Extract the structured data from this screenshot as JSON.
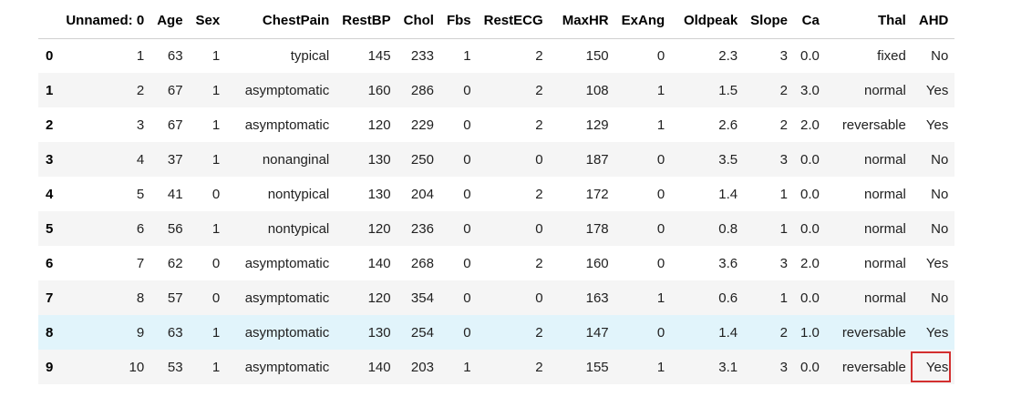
{
  "table": {
    "columns": [
      "",
      "Unnamed: 0",
      "Age",
      "Sex",
      "ChestPain",
      "RestBP",
      "Chol",
      "Fbs",
      "RestECG",
      "MaxHR",
      "ExAng",
      "Oldpeak",
      "Slope",
      "Ca",
      "Thal",
      "AHD"
    ],
    "rows": [
      {
        "index": "0",
        "cells": [
          "1",
          "63",
          "1",
          "typical",
          "145",
          "233",
          "1",
          "2",
          "150",
          "0",
          "2.3",
          "3",
          "0.0",
          "fixed",
          "No"
        ]
      },
      {
        "index": "1",
        "cells": [
          "2",
          "67",
          "1",
          "asymptomatic",
          "160",
          "286",
          "0",
          "2",
          "108",
          "1",
          "1.5",
          "2",
          "3.0",
          "normal",
          "Yes"
        ]
      },
      {
        "index": "2",
        "cells": [
          "3",
          "67",
          "1",
          "asymptomatic",
          "120",
          "229",
          "0",
          "2",
          "129",
          "1",
          "2.6",
          "2",
          "2.0",
          "reversable",
          "Yes"
        ]
      },
      {
        "index": "3",
        "cells": [
          "4",
          "37",
          "1",
          "nonanginal",
          "130",
          "250",
          "0",
          "0",
          "187",
          "0",
          "3.5",
          "3",
          "0.0",
          "normal",
          "No"
        ]
      },
      {
        "index": "4",
        "cells": [
          "5",
          "41",
          "0",
          "nontypical",
          "130",
          "204",
          "0",
          "2",
          "172",
          "0",
          "1.4",
          "1",
          "0.0",
          "normal",
          "No"
        ]
      },
      {
        "index": "5",
        "cells": [
          "6",
          "56",
          "1",
          "nontypical",
          "120",
          "236",
          "0",
          "0",
          "178",
          "0",
          "0.8",
          "1",
          "0.0",
          "normal",
          "No"
        ]
      },
      {
        "index": "6",
        "cells": [
          "7",
          "62",
          "0",
          "asymptomatic",
          "140",
          "268",
          "0",
          "2",
          "160",
          "0",
          "3.6",
          "3",
          "2.0",
          "normal",
          "Yes"
        ]
      },
      {
        "index": "7",
        "cells": [
          "8",
          "57",
          "0",
          "asymptomatic",
          "120",
          "354",
          "0",
          "0",
          "163",
          "1",
          "0.6",
          "1",
          "0.0",
          "normal",
          "No"
        ]
      },
      {
        "index": "8",
        "cells": [
          "9",
          "63",
          "1",
          "asymptomatic",
          "130",
          "254",
          "0",
          "2",
          "147",
          "0",
          "1.4",
          "2",
          "1.0",
          "reversable",
          "Yes"
        ]
      },
      {
        "index": "9",
        "cells": [
          "10",
          "53",
          "1",
          "asymptomatic",
          "140",
          "203",
          "1",
          "2",
          "155",
          "1",
          "3.1",
          "3",
          "0.0",
          "reversable",
          "Yes"
        ]
      }
    ],
    "hovered_row": 8,
    "highlighted_cell": {
      "row": 9,
      "column": "AHD"
    }
  },
  "colors": {
    "hover_row": "#e1f4fb",
    "striped_row": "#f5f5f5",
    "highlight_box": "#d32f2f"
  }
}
